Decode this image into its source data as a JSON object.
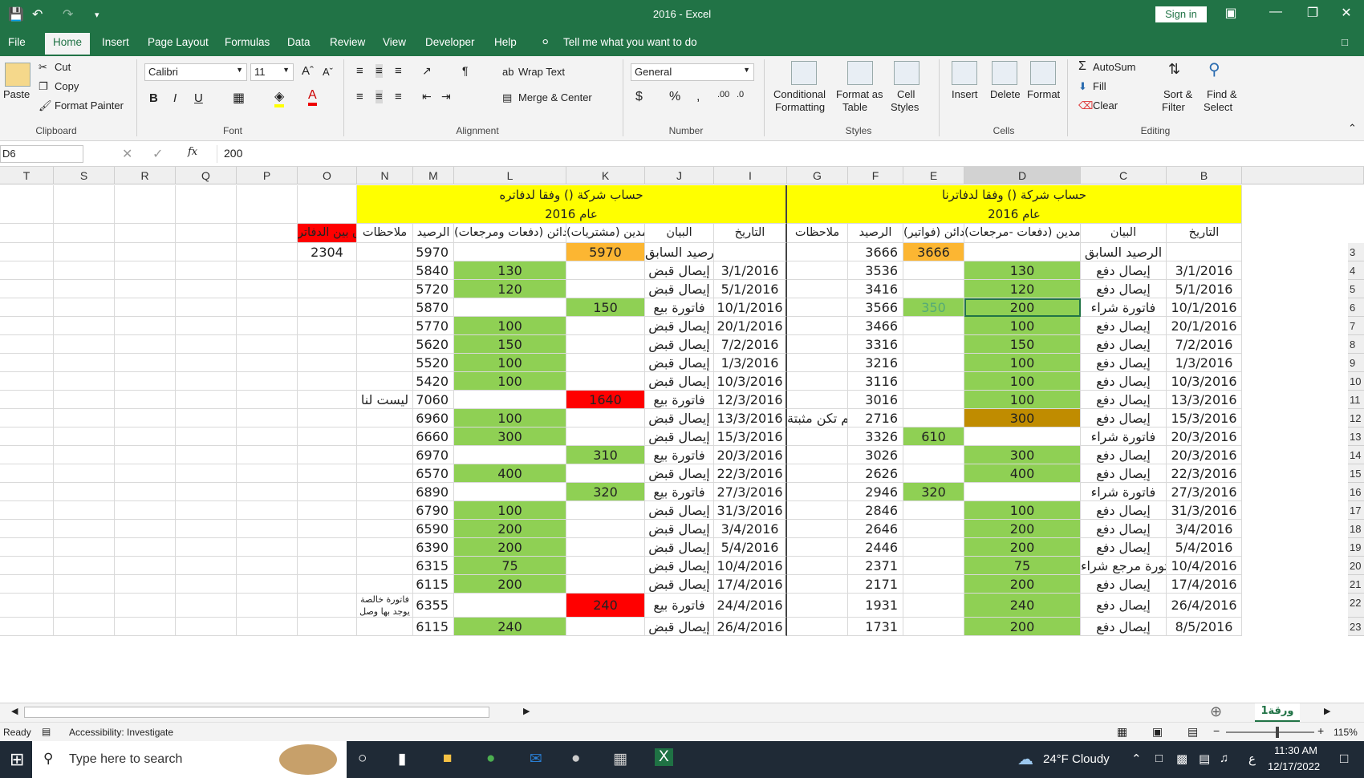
{
  "titlebar": {
    "title": "2016  -  Excel",
    "signin": "Sign in"
  },
  "menu": [
    "File",
    "Home",
    "Insert",
    "Page Layout",
    "Formulas",
    "Data",
    "Review",
    "View",
    "Developer",
    "Help",
    "Tell me what you want to do"
  ],
  "ribbon": {
    "clipboard": {
      "paste": "Paste",
      "cut": "Cut",
      "copy": "Copy",
      "format_painter": "Format Painter",
      "label": "Clipboard"
    },
    "font": {
      "name": "Calibri",
      "size": "11",
      "label": "Font"
    },
    "alignment": {
      "wrap": "Wrap Text",
      "merge": "Merge & Center",
      "label": "Alignment"
    },
    "number": {
      "format": "General",
      "label": "Number"
    },
    "styles": {
      "conditional": "Conditional",
      "conditional2": "Formatting",
      "format_as": "Format as",
      "format_as2": "Table",
      "cell": "Cell",
      "cell2": "Styles",
      "label": "Styles"
    },
    "cells": {
      "insert": "Insert",
      "delete": "Delete",
      "format": "Format",
      "label": "Cells"
    },
    "editing": {
      "autosum": "AutoSum",
      "fill": "Fill",
      "clear": "Clear",
      "sort": "Sort &",
      "sort2": "Filter",
      "find": "Find &",
      "find2": "Select",
      "label": "Editing"
    }
  },
  "formula": {
    "namebox": "D6",
    "fx": "fx",
    "value": "200"
  },
  "columns": [
    "T",
    "S",
    "R",
    "Q",
    "P",
    "O",
    "N",
    "M",
    "L",
    "K",
    "J",
    "I",
    "G",
    "F",
    "E",
    "D",
    "C",
    "B"
  ],
  "headers": {
    "left_title": "حساب شركة () وفقا لدفاتره",
    "left_year": "عام 2016",
    "right_title": "حساب شركة () وفقا لدفاترنا",
    "right_year": "عام 2016",
    "diff": "الفرق بين الدفاتر",
    "notes": "ملاحظات",
    "balance": "الرصيد",
    "credit_left": "دائن (دفعات ومرجعات)",
    "debit_left": "مدين (مشتريات)",
    "desc": "البيان",
    "date": "التاريخ",
    "credit_right": "دائن (فواتير)",
    "debit_right": "مدين (دفعات -مرجعات)"
  },
  "rows": [
    {
      "n": "3",
      "O": "2304",
      "M": "5970",
      "L": "",
      "K": "5970",
      "J": "الرصيد السابق",
      "I": "",
      "G": "",
      "F": "3666",
      "E": "3666",
      "D": "",
      "C": "الرصيد السابق",
      "B": ""
    },
    {
      "n": "4",
      "M": "5840",
      "L": "130",
      "K": "",
      "J": "إيصال قبض",
      "I": "3/1/2016",
      "F": "3536",
      "E": "",
      "D": "130",
      "C": "إيصال دفع",
      "B": "3/1/2016"
    },
    {
      "n": "5",
      "M": "5720",
      "L": "120",
      "K": "",
      "J": "إيصال قبض",
      "I": "5/1/2016",
      "F": "3416",
      "E": "",
      "D": "120",
      "C": "إيصال دفع",
      "B": "5/1/2016"
    },
    {
      "n": "6",
      "M": "5870",
      "L": "",
      "K": "150",
      "J": "فاتورة بيع",
      "I": "10/1/2016",
      "F": "3566",
      "E": "350",
      "D": "200",
      "C": "فاتورة شراء",
      "B": "10/1/2016"
    },
    {
      "n": "7",
      "M": "5770",
      "L": "100",
      "K": "",
      "J": "إيصال قبض",
      "I": "20/1/2016",
      "F": "3466",
      "E": "",
      "D": "100",
      "C": "إيصال دفع",
      "B": "20/1/2016"
    },
    {
      "n": "8",
      "M": "5620",
      "L": "150",
      "K": "",
      "J": "إيصال قبض",
      "I": "7/2/2016",
      "F": "3316",
      "E": "",
      "D": "150",
      "C": "إيصال دفع",
      "B": "7/2/2016"
    },
    {
      "n": "9",
      "M": "5520",
      "L": "100",
      "K": "",
      "J": "إيصال قبض",
      "I": "1/3/2016",
      "F": "3216",
      "E": "",
      "D": "100",
      "C": "إيصال دفع",
      "B": "1/3/2016"
    },
    {
      "n": "10",
      "M": "5420",
      "L": "100",
      "K": "",
      "J": "إيصال قبض",
      "I": "10/3/2016",
      "F": "3116",
      "E": "",
      "D": "100",
      "C": "إيصال دفع",
      "B": "10/3/2016"
    },
    {
      "n": "11",
      "N": "ليست لنا",
      "M": "7060",
      "L": "",
      "K": "1640",
      "J": "فاتورة بيع",
      "I": "12/3/2016",
      "F": "3016",
      "E": "",
      "D": "100",
      "C": "إيصال دفع",
      "B": "13/3/2016"
    },
    {
      "n": "12",
      "M": "6960",
      "L": "100",
      "K": "",
      "J": "إيصال قبض",
      "I": "13/3/2016",
      "G": "لم تكن مثبتة",
      "F": "2716",
      "E": "",
      "D": "300",
      "C": "إيصال دفع",
      "B": "15/3/2016"
    },
    {
      "n": "13",
      "M": "6660",
      "L": "300",
      "K": "",
      "J": "إيصال قبض",
      "I": "15/3/2016",
      "F": "3326",
      "E": "610",
      "D": "",
      "C": "فاتورة شراء",
      "B": "20/3/2016"
    },
    {
      "n": "14",
      "M": "6970",
      "L": "",
      "K": "310",
      "J": "فاتورة بيع",
      "I": "20/3/2016",
      "F": "3026",
      "E": "",
      "D": "300",
      "C": "إيصال دفع",
      "B": "20/3/2016"
    },
    {
      "n": "15",
      "M": "6570",
      "L": "400",
      "K": "",
      "J": "إيصال قبض",
      "I": "22/3/2016",
      "F": "2626",
      "E": "",
      "D": "400",
      "C": "إيصال دفع",
      "B": "22/3/2016"
    },
    {
      "n": "16",
      "M": "6890",
      "L": "",
      "K": "320",
      "J": "فاتورة بيع",
      "I": "27/3/2016",
      "F": "2946",
      "E": "320",
      "D": "",
      "C": "فاتورة شراء",
      "B": "27/3/2016"
    },
    {
      "n": "17",
      "M": "6790",
      "L": "100",
      "K": "",
      "J": "إيصال قبض",
      "I": "31/3/2016",
      "F": "2846",
      "E": "",
      "D": "100",
      "C": "إيصال دفع",
      "B": "31/3/2016"
    },
    {
      "n": "18",
      "M": "6590",
      "L": "200",
      "K": "",
      "J": "إيصال قبض",
      "I": "3/4/2016",
      "F": "2646",
      "E": "",
      "D": "200",
      "C": "إيصال دفع",
      "B": "3/4/2016"
    },
    {
      "n": "19",
      "M": "6390",
      "L": "200",
      "K": "",
      "J": "إيصال قبض",
      "I": "5/4/2016",
      "F": "2446",
      "E": "",
      "D": "200",
      "C": "إيصال دفع",
      "B": "5/4/2016"
    },
    {
      "n": "20",
      "M": "6315",
      "L": "75",
      "K": "",
      "J": "إيصال قبض",
      "I": "10/4/2016",
      "F": "2371",
      "E": "",
      "D": "75",
      "C": "فاتورة مرجع شراء",
      "B": "10/4/2016"
    },
    {
      "n": "21",
      "M": "6115",
      "L": "200",
      "K": "",
      "J": "إيصال قبض",
      "I": "17/4/2016",
      "F": "2171",
      "E": "",
      "D": "200",
      "C": "إيصال دفع",
      "B": "17/4/2016"
    },
    {
      "n": "22",
      "N": "فاتورة خالصة يوجد بها وصل",
      "M": "6355",
      "L": "",
      "K": "240",
      "J": "فاتورة بيع",
      "I": "24/4/2016",
      "F": "1931",
      "E": "",
      "D": "240",
      "C": "إيصال دفع",
      "B": "26/4/2016"
    },
    {
      "n": "23",
      "M": "6115",
      "L": "240",
      "K": "",
      "J": "إيصال قبض",
      "I": "26/4/2016",
      "F": "1731",
      "E": "",
      "D": "200",
      "C": "إيصال دفع",
      "B": "8/5/2016"
    }
  ],
  "sheet": {
    "name": "ورقة1",
    "ready": "Ready",
    "accessibility": "Accessibility: Investigate",
    "zoom": "115%"
  },
  "taskbar": {
    "search": "Type here to search",
    "weather": "24°F  Cloudy",
    "time": "11:30 AM",
    "date": "12/17/2022"
  }
}
